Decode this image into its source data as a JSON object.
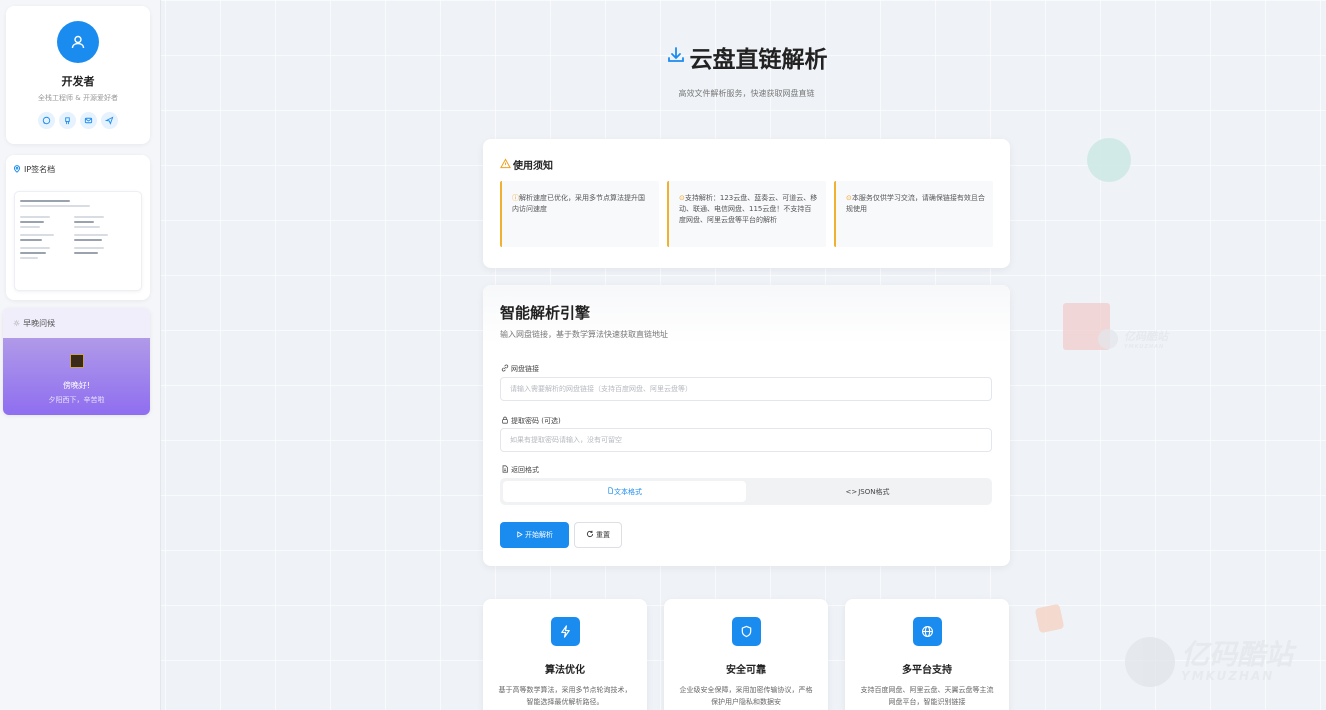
{
  "profile": {
    "name": "开发者",
    "description": "全栈工程师 & 开源爱好者",
    "social_icons": [
      "chat-icon",
      "github-icon",
      "mail-icon",
      "send-icon"
    ]
  },
  "ip_card": {
    "title": "IP签名档"
  },
  "greeting": {
    "title": "早晚问候",
    "text": "傍晚好!",
    "subtext": "夕阳西下，辛苦啦"
  },
  "header": {
    "title": "云盘直链解析",
    "subtitle": "高效文件解析服务，快速获取网盘直链"
  },
  "notice": {
    "title": "使用须知",
    "items": [
      "解析速度已优化，采用多节点算法提升国内访问速度",
      "支持解析：123云盘、蓝奏云、可道云、移动、联通、电信网盘、115云盘！不支持百度网盘、阿里云盘等平台的解析",
      "本服务仅供学习交流，请确保链接有效且合规使用"
    ]
  },
  "engine": {
    "title": "智能解析引擎",
    "subtitle": "输入网盘链接，基于数学算法快速获取直链地址",
    "link_label": "网盘链接",
    "link_placeholder": "请输入需要解析的网盘链接（支持百度网盘、阿里云盘等）",
    "password_label": "提取密码 (可选)",
    "password_placeholder": "如果有提取密码请输入，没有可留空",
    "format_label": "返回格式",
    "format_options": [
      "文本格式",
      "JSON格式"
    ],
    "selected_format": "文本格式",
    "start_button": "开始解析",
    "reset_button": "重置"
  },
  "features": [
    {
      "title": "算法优化",
      "description": "基于高等数学算法，采用多节点轮询技术，智能选择最优解析路径。",
      "icon": "lightning-icon"
    },
    {
      "title": "安全可靠",
      "description": "企业级安全保障，采用加密传输协议，严格保护用户隐私和数据安",
      "icon": "shield-icon"
    },
    {
      "title": "多平台支持",
      "description": "支持百度网盘、阿里云盘、天翼云盘等主流网盘平台，智能识别链接",
      "icon": "globe-icon"
    }
  ],
  "watermark": {
    "brand": "亿码酷站",
    "brand_en": "YMKUZHAN"
  },
  "colors": {
    "accent": "#1a8cf0",
    "warning": "#f0b030",
    "greeting_gradient_end": "#8f6ef0"
  }
}
